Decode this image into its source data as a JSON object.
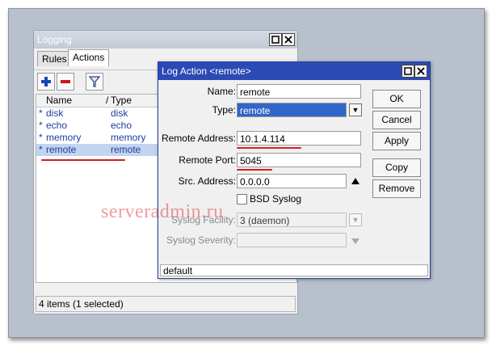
{
  "watermark": "serveradmin.ru",
  "colors": {
    "selection": "#3165c8",
    "title_active": "#2b4ab5",
    "underline": "#d61e1e",
    "item_text": "#1f3c9e"
  },
  "logging": {
    "title": "Logging",
    "tabs": [
      {
        "label": "Rules"
      },
      {
        "label": "Actions"
      }
    ],
    "active_tab": "Actions",
    "toolbar": {
      "add": "plus-icon",
      "remove": "minus-icon",
      "filter": "filter-icon"
    },
    "columns": [
      "Name",
      "Type"
    ],
    "rows": [
      {
        "mark": "*",
        "name": "disk",
        "type": "disk"
      },
      {
        "mark": "*",
        "name": "echo",
        "type": "echo"
      },
      {
        "mark": "*",
        "name": "memory",
        "type": "memory"
      },
      {
        "mark": "*",
        "name": "remote",
        "type": "remote"
      }
    ],
    "selected_row": 3,
    "status": "4 items (1 selected)"
  },
  "dialog": {
    "title": "Log Action <remote>",
    "fields": {
      "name": {
        "label": "Name:",
        "value": "remote"
      },
      "type": {
        "label": "Type:",
        "value": "remote"
      },
      "remote_address": {
        "label": "Remote Address:",
        "value": "10.1.4.114"
      },
      "remote_port": {
        "label": "Remote Port:",
        "value": "5045"
      },
      "src_address": {
        "label": "Src. Address:",
        "value": "0.0.0.0"
      },
      "bsd_syslog": {
        "label": "BSD Syslog",
        "checked": false
      },
      "syslog_facility": {
        "label": "Syslog Facility:",
        "value": "3 (daemon)"
      },
      "syslog_severity": {
        "label": "Syslog Severity:",
        "value": ""
      }
    },
    "buttons": {
      "ok": "OK",
      "cancel": "Cancel",
      "apply": "Apply",
      "copy": "Copy",
      "remove": "Remove"
    },
    "status": "default"
  }
}
